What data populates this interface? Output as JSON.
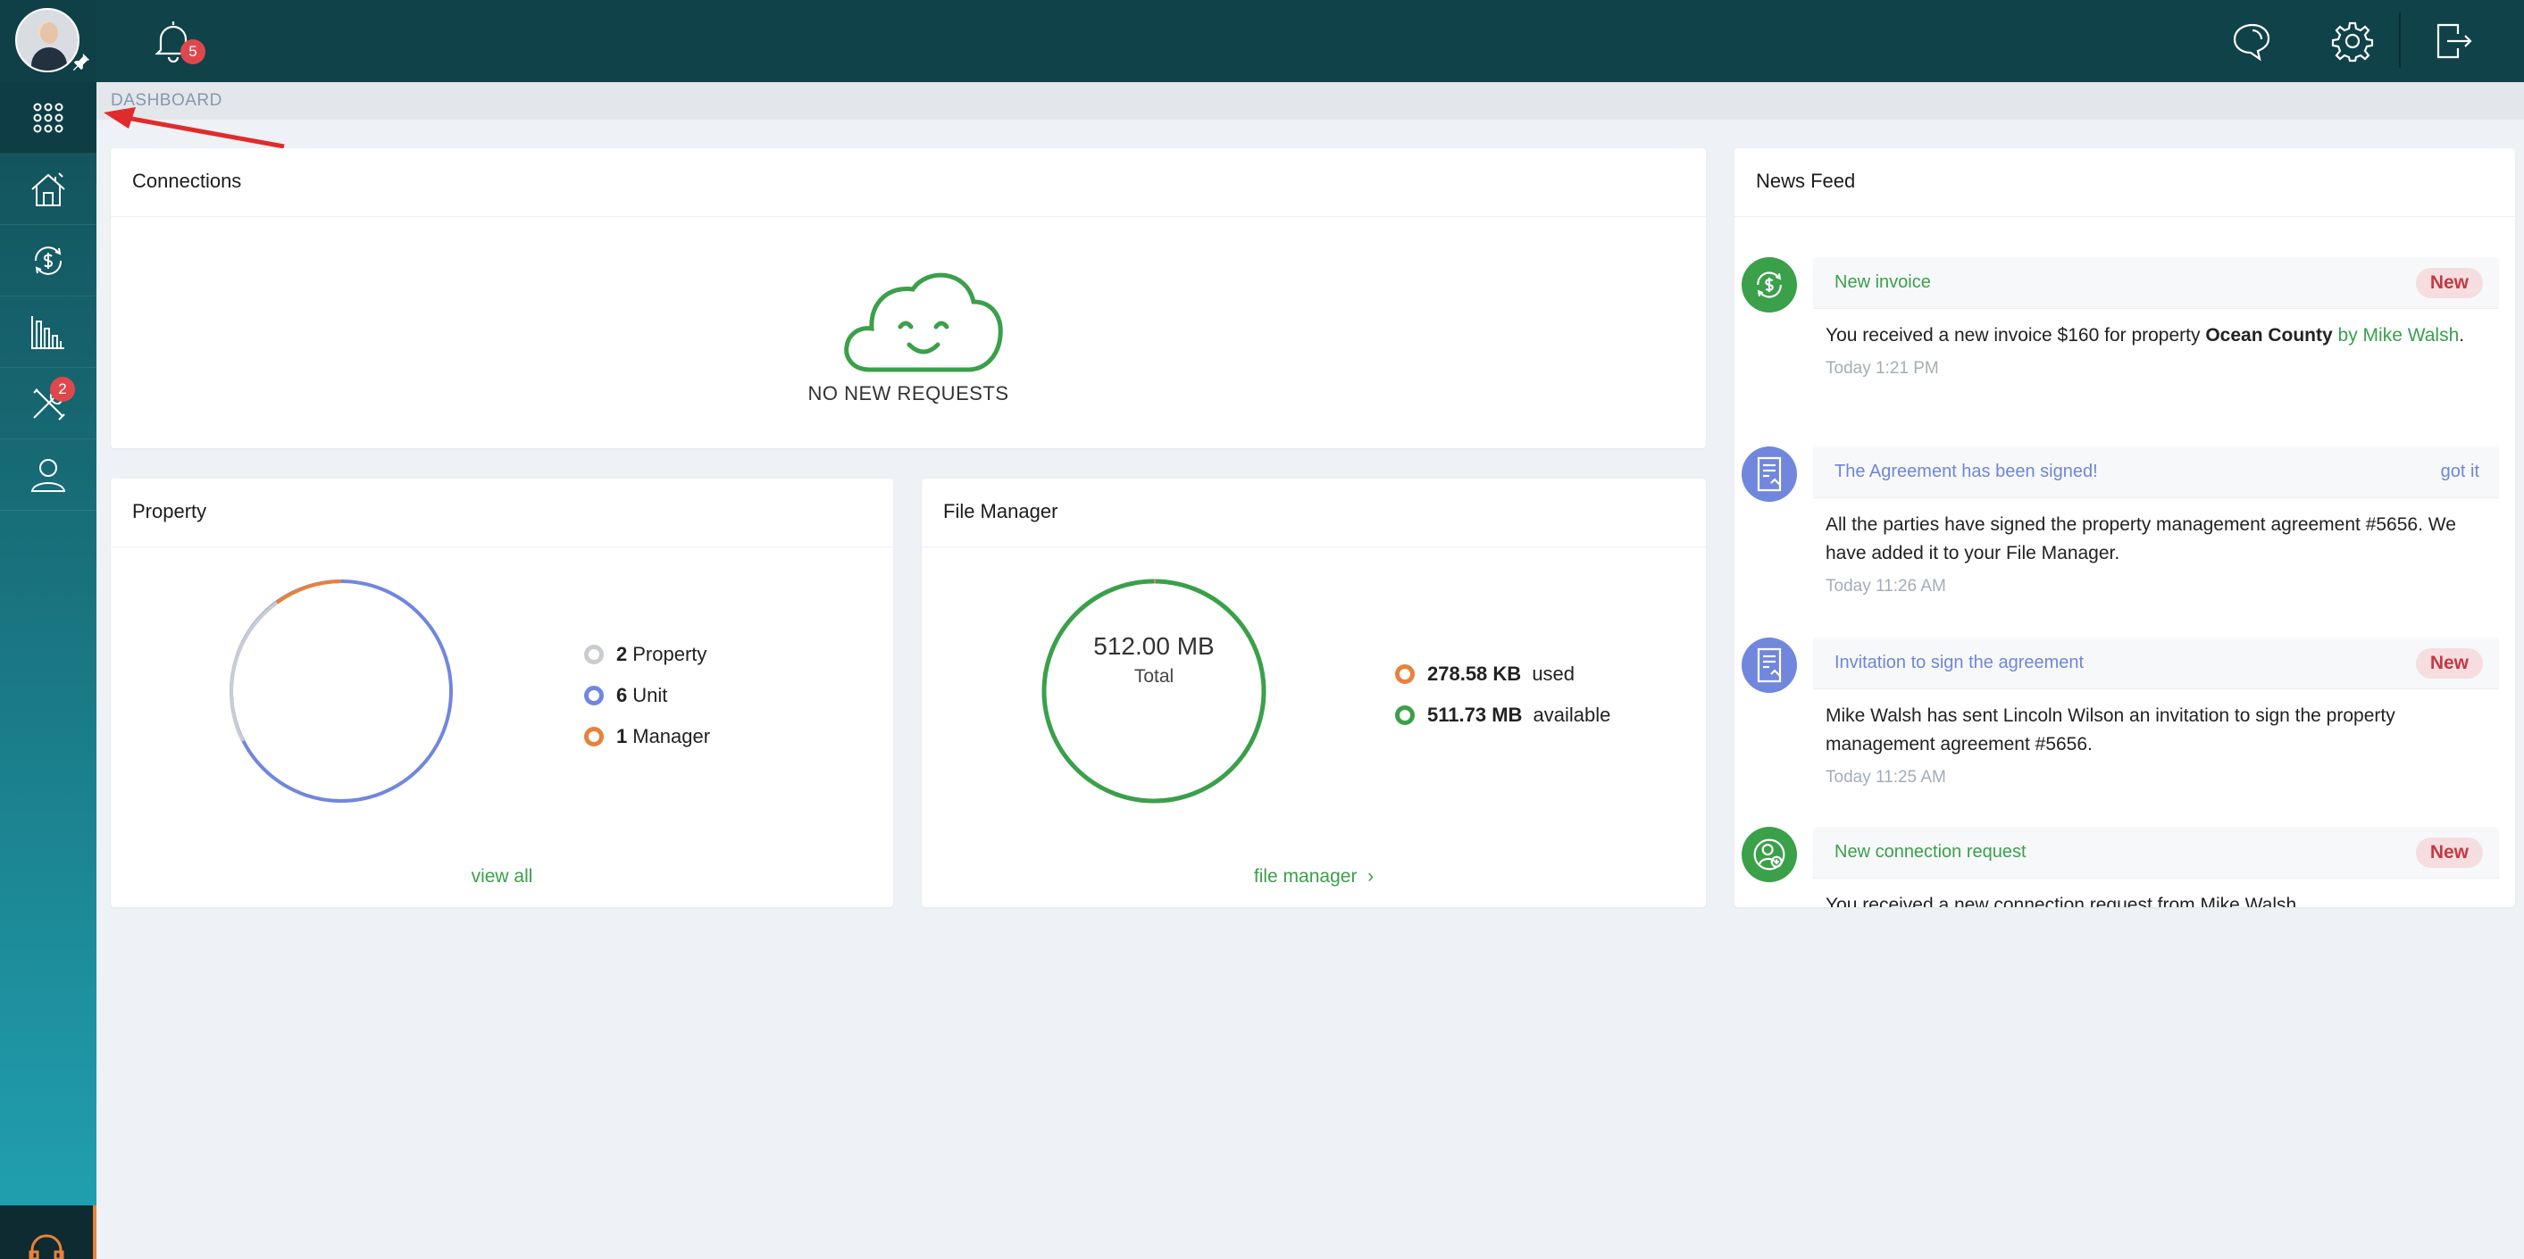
{
  "topbar": {
    "notification_count": "5"
  },
  "sidebar": {
    "maintenance_badge": "2"
  },
  "breadcrumb": "DASHBOARD",
  "connections": {
    "title": "Connections",
    "empty_text": "NO NEW REQUESTS"
  },
  "property": {
    "title": "Property",
    "legend": [
      {
        "count": "2",
        "label": "Property",
        "color": "#c9ccd2"
      },
      {
        "count": "6",
        "label": "Unit",
        "color": "#7187dd"
      },
      {
        "count": "1",
        "label": "Manager",
        "color": "#e8823a"
      }
    ],
    "link": "view all"
  },
  "file_manager": {
    "title": "File Manager",
    "total_value": "512.00 MB",
    "total_label": "Total",
    "used_value": "278.58 KB",
    "used_label": "used",
    "available_value": "511.73 MB",
    "available_label": "available",
    "link": "file manager"
  },
  "news_feed": {
    "title": "News Feed",
    "items": [
      {
        "title": "New invoice",
        "badge": "New",
        "text_prefix": "You received a new invoice $160 for property ",
        "text_bold": "Ocean County",
        "text_link": " by Mike Walsh",
        "text_suffix": ".",
        "time": "Today 1:21 PM"
      },
      {
        "title": "The Agreement has been signed!",
        "action": "got it",
        "text": "All the parties have signed the property management agreement #5656. We have added it to your File Manager.",
        "time": "Today 11:26 AM"
      },
      {
        "title": "Invitation to sign the agreement",
        "badge": "New",
        "text": "Mike Walsh has sent Lincoln Wilson an invitation to sign the property management agreement #5656.",
        "time": "Today 11:25 AM"
      },
      {
        "title": "New connection request",
        "badge": "New",
        "text": "You received a new connection request from Mike Walsh"
      }
    ]
  },
  "colors": {
    "accent_green": "#3aa04a",
    "accent_blue": "#7187dd",
    "accent_orange": "#e8823a",
    "badge_red": "#e0474c"
  }
}
